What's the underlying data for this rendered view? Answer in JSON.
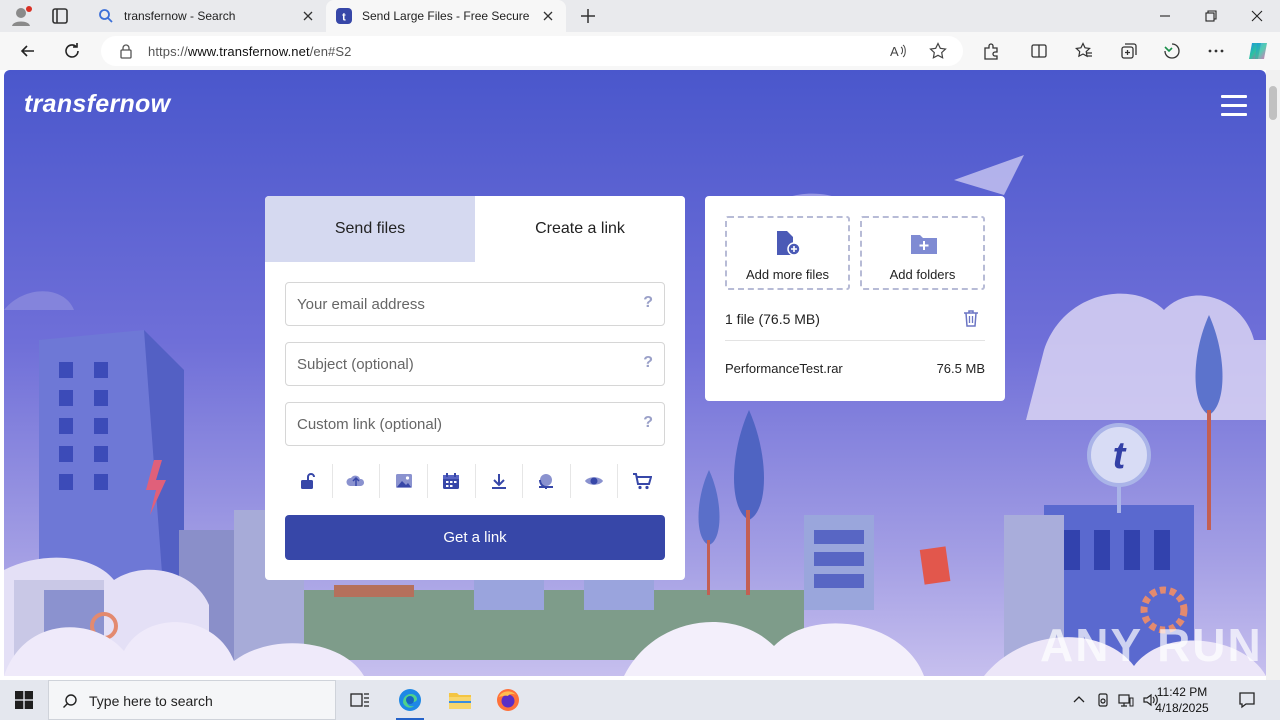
{
  "browser": {
    "tabs": [
      {
        "label": "transfernow - Search",
        "active": false
      },
      {
        "label": "Send Large Files - Free Secure File",
        "active": true
      }
    ],
    "url_prefix": "https://",
    "url_domain": "www.transfernow.net",
    "url_path": "/en#S2"
  },
  "page": {
    "brand": "transfernow",
    "form": {
      "tab_send": "Send files",
      "tab_link": "Create a link",
      "email_placeholder": "Your email address",
      "subject_placeholder": "Subject (optional)",
      "custom_link_placeholder": "Custom link (optional)",
      "help_glyph": "?",
      "option_icons": [
        "lock-icon",
        "cloud-icon",
        "image-icon",
        "calendar-icon",
        "download-icon",
        "globe-icon",
        "eye-icon",
        "cart-icon"
      ],
      "submit_label": "Get a link"
    },
    "files": {
      "add_more_label": "Add more files",
      "add_folders_label": "Add folders",
      "summary": "1 file (76.5 MB)",
      "items": [
        {
          "name": "PerformanceTest.rar",
          "size": "76.5 MB"
        }
      ]
    },
    "watermark": "ANY RUN"
  },
  "taskbar": {
    "search_placeholder": "Type here to search",
    "time": "11:42 PM",
    "date": "4/18/2025"
  },
  "colors": {
    "accent": "#3747a8",
    "sky_top": "#4d5bd0",
    "sky_bottom": "#a9a3e6",
    "tab_inactive": "#d5d9f0"
  }
}
